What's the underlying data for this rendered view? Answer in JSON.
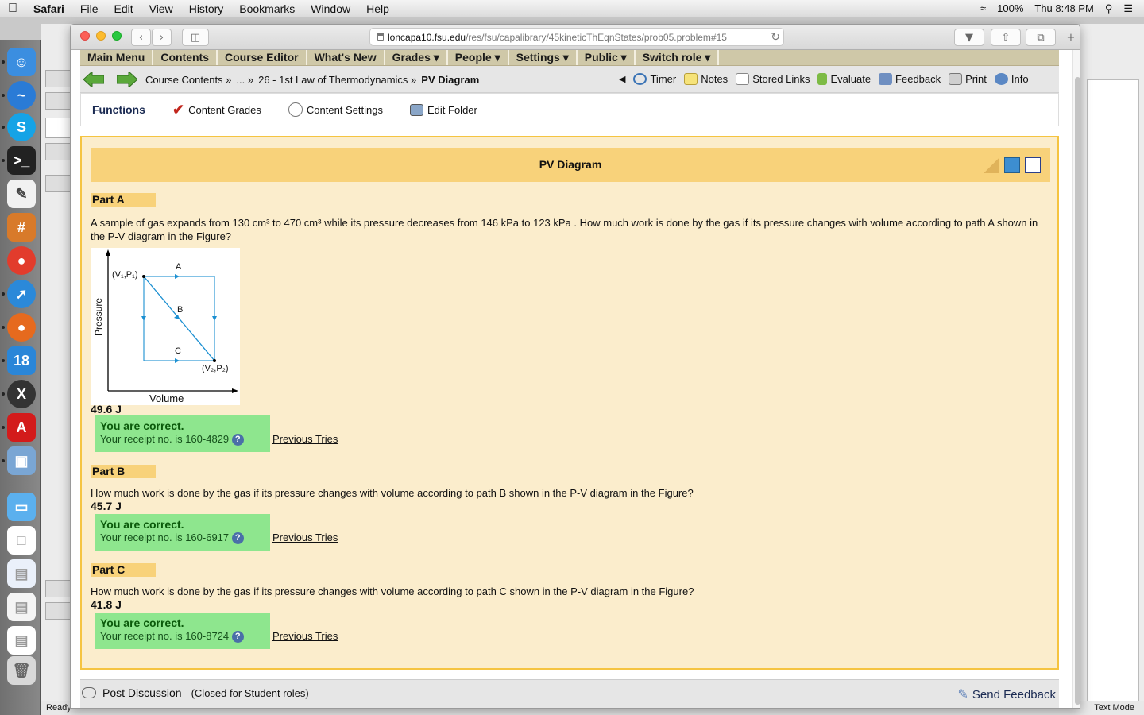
{
  "menubar": {
    "app": "Safari",
    "items": [
      "File",
      "Edit",
      "View",
      "History",
      "Bookmarks",
      "Window",
      "Help"
    ],
    "battery": "100%",
    "clock": "Thu 8:48 PM"
  },
  "browser": {
    "url_domain": "loncapa10.fsu.edu",
    "url_path": "/res/fsu/capalibrary/45kineticThEqnStates/prob05.problem#15"
  },
  "nav1": [
    "Main Menu",
    "Contents",
    "Course Editor",
    "What's New",
    "Grades ▾",
    "People ▾",
    "Settings ▾",
    "Public ▾",
    "Switch role ▾"
  ],
  "breadcrumb": {
    "items": [
      "Course Contents »",
      "... »",
      "26 - 1st Law of Thermodynamics »"
    ],
    "current": "PV Diagram"
  },
  "tools": [
    "Timer",
    "Notes",
    "Stored Links",
    "Evaluate",
    "Feedback",
    "Print",
    "Info"
  ],
  "functions": {
    "label": "Functions",
    "items": [
      "Content Grades",
      "Content Settings",
      "Edit Folder"
    ]
  },
  "problem": {
    "title": "PV Diagram",
    "parts": [
      {
        "label": "Part A",
        "question": "A sample of gas expands from 130 cm³ to 470 cm³ while its pressure decreases from 146 kPa to 123 kPa . How much work is done by the gas if its pressure changes with volume according to path A shown in the P-V diagram in the Figure?",
        "answer": "49.6 J",
        "status": "You are correct.",
        "receipt": "Your receipt no. is 160-4829",
        "prev": "Previous Tries"
      },
      {
        "label": "Part B",
        "question": "How much work is done by the gas if its pressure changes with volume according to path B shown in the P-V diagram in the Figure?",
        "answer": "45.7 J",
        "status": "You are correct.",
        "receipt": "Your receipt no. is 160-6917",
        "prev": "Previous Tries"
      },
      {
        "label": "Part C",
        "question": "How much work is done by the gas if its pressure changes with volume according to path C shown in the P-V diagram in the Figure?",
        "answer": "41.8 J",
        "status": "You are correct.",
        "receipt": "Your receipt no. is 160-8724",
        "prev": "Previous Tries"
      }
    ],
    "figure": {
      "ylabel": "Pressure",
      "xlabel": "Volume",
      "p1": "(V₁,P₁)",
      "p2": "(V₂,P₂)",
      "pathA": "A",
      "pathB": "B",
      "pathC": "C"
    }
  },
  "footer": {
    "post": "Post Discussion",
    "closed": "(Closed for Student roles)",
    "send": "Send Feedback"
  },
  "statusbar": {
    "left": "Ready",
    "right": "Text Mode"
  },
  "colors": {
    "nav_bg": "#cfc8a8",
    "problem_bg": "#fbedcc",
    "problem_border": "#f5c441",
    "title_bg": "#f8d27a",
    "correct_bg": "#8ee68e",
    "figure_lines": "#1b8fd1"
  }
}
